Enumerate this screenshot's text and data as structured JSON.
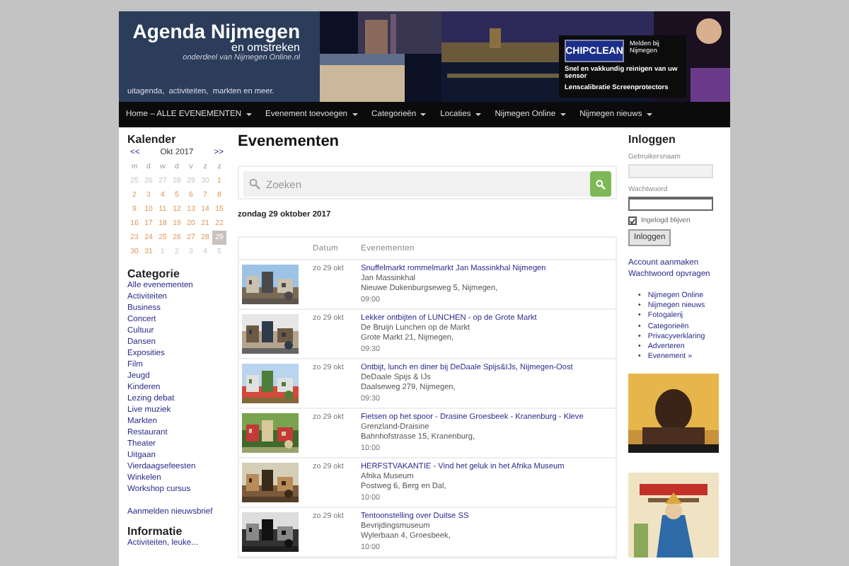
{
  "header": {
    "title": "Agenda Nijmegen",
    "subtitle": "en omstreken",
    "tagline": "onderdeel van Nijmegen Online.nl",
    "slogan": "uitagenda,  activiteiten,  markten en meer.",
    "ad": {
      "logo": "CHIPCLEAN",
      "side": "Melden bij Nijmegen",
      "lines": [
        "Snel en vakkundig reinigen van uw sensor",
        "Lenscalibratie  Screenprotectors"
      ]
    }
  },
  "nav": [
    {
      "label": "Home – ALLE EVENEMENTEN",
      "dropdown": true
    },
    {
      "label": "Evenement toevoegen",
      "dropdown": true
    },
    {
      "label": "Categorieën",
      "dropdown": true
    },
    {
      "label": "Locaties",
      "dropdown": true
    },
    {
      "label": "Nijmegen Online",
      "dropdown": true
    },
    {
      "label": "Nijmegen nieuws",
      "dropdown": true
    }
  ],
  "calendar": {
    "title": "Kalender",
    "prev": "<<",
    "month": "Okt 2017",
    "next": ">>",
    "weekdays": [
      "m",
      "d",
      "w",
      "d",
      "v",
      "z",
      "z"
    ],
    "days": [
      {
        "day": "25",
        "in_month": false,
        "selected": false
      },
      {
        "day": "26",
        "in_month": false,
        "selected": false
      },
      {
        "day": "27",
        "in_month": false,
        "selected": false
      },
      {
        "day": "28",
        "in_month": false,
        "selected": false
      },
      {
        "day": "29",
        "in_month": false,
        "selected": false
      },
      {
        "day": "30",
        "in_month": false,
        "selected": false
      },
      {
        "day": "1",
        "in_month": true,
        "selected": false
      },
      {
        "day": "2",
        "in_month": true,
        "selected": false
      },
      {
        "day": "3",
        "in_month": true,
        "selected": false
      },
      {
        "day": "4",
        "in_month": true,
        "selected": false
      },
      {
        "day": "5",
        "in_month": true,
        "selected": false
      },
      {
        "day": "6",
        "in_month": true,
        "selected": false
      },
      {
        "day": "7",
        "in_month": true,
        "selected": false
      },
      {
        "day": "8",
        "in_month": true,
        "selected": false
      },
      {
        "day": "9",
        "in_month": true,
        "selected": false
      },
      {
        "day": "10",
        "in_month": true,
        "selected": false
      },
      {
        "day": "11",
        "in_month": true,
        "selected": false
      },
      {
        "day": "12",
        "in_month": true,
        "selected": false
      },
      {
        "day": "13",
        "in_month": true,
        "selected": false
      },
      {
        "day": "14",
        "in_month": true,
        "selected": false
      },
      {
        "day": "15",
        "in_month": true,
        "selected": false
      },
      {
        "day": "16",
        "in_month": true,
        "selected": false
      },
      {
        "day": "17",
        "in_month": true,
        "selected": false
      },
      {
        "day": "18",
        "in_month": true,
        "selected": false
      },
      {
        "day": "19",
        "in_month": true,
        "selected": false
      },
      {
        "day": "20",
        "in_month": true,
        "selected": false
      },
      {
        "day": "21",
        "in_month": true,
        "selected": false
      },
      {
        "day": "22",
        "in_month": true,
        "selected": false
      },
      {
        "day": "23",
        "in_month": true,
        "selected": false
      },
      {
        "day": "24",
        "in_month": true,
        "selected": false
      },
      {
        "day": "25",
        "in_month": true,
        "selected": false
      },
      {
        "day": "26",
        "in_month": true,
        "selected": false
      },
      {
        "day": "27",
        "in_month": true,
        "selected": false
      },
      {
        "day": "28",
        "in_month": true,
        "selected": false
      },
      {
        "day": "29",
        "in_month": true,
        "selected": true
      },
      {
        "day": "30",
        "in_month": true,
        "selected": false
      },
      {
        "day": "31",
        "in_month": true,
        "selected": false
      },
      {
        "day": "1",
        "in_month": false,
        "selected": false
      },
      {
        "day": "2",
        "in_month": false,
        "selected": false
      },
      {
        "day": "3",
        "in_month": false,
        "selected": false
      },
      {
        "day": "4",
        "in_month": false,
        "selected": false
      },
      {
        "day": "5",
        "in_month": false,
        "selected": false
      }
    ]
  },
  "categories": {
    "title": "Categorie",
    "items": [
      "Alle evenementen",
      "Activiteiten",
      "Business",
      "Concert",
      "Cultuur",
      "Dansen",
      "Exposities",
      "Film",
      "Jeugd",
      "Kinderen",
      "Lezing debat",
      "Live muziek",
      "Markten",
      "Restaurant",
      "Theater",
      "Uitgaan",
      "Vierdaagsefeesten",
      "Winkelen",
      "Workshop cursus"
    ]
  },
  "newsletter_link": "Aanmelden nieuwsbrief",
  "info": {
    "title": "Informatie",
    "items": [
      "Activiteiten, leuke..."
    ]
  },
  "main": {
    "title": "Evenementen",
    "search": {
      "placeholder": "Zoeken"
    },
    "date_heading": "zondag 29 oktober 2017",
    "columns": [
      "Datum",
      "Evenementen"
    ],
    "rows": [
      {
        "date": "zo 29 okt",
        "title": "Snuffelmarkt rommelmarkt Jan Massinkhal Nijmegen",
        "venue": "Jan Massinkhal",
        "address": "Nieuwe Dukenburgseweg 5, Nijmegen,",
        "time": "09:00"
      },
      {
        "date": "zo 29 okt",
        "title": "Lekker ontbijten of LUNCHEN - op de Grote Markt",
        "venue": "De Bruijn Lunchen op de Markt",
        "address": "Grote Markt 21, Nijmegen,",
        "time": "09:30"
      },
      {
        "date": "zo 29 okt",
        "title": "Ontbijt, lunch en diner bij DeDaale Spijs&IJs, Nijmegen-Oost",
        "venue": "DeDaale Spijs & IJs",
        "address": "Daalseweg 279, Nijmegen,",
        "time": "09:30"
      },
      {
        "date": "zo 29 okt",
        "title": "Fietsen op het spoor - Drasine Groesbeek - Kranenburg - Kleve",
        "venue": "Grenzland-Draisine",
        "address": "Bahnhofstrasse 15, Kranenburg,",
        "time": "10:00"
      },
      {
        "date": "zo 29 okt",
        "title": "HERFSTVAKANTIE - Vind het geluk in het Afrika Museum",
        "venue": "Afrika Museum",
        "address": "Postweg 6, Berg en Dal,",
        "time": "10:00"
      },
      {
        "date": "zo 29 okt",
        "title": "Tentoonstelling over Duitse SS",
        "venue": "Bevrijdingsmuseum",
        "address": "Wylerbaan 4, Groesbeek,",
        "time": "10:00"
      }
    ]
  },
  "login": {
    "title": "Inloggen",
    "username_label": "Gebruikersnaam",
    "password_label": "Wachtwoord",
    "remember": {
      "label": "Ingelogd blijven",
      "checked": true
    },
    "button": "Inloggen",
    "links": [
      "Account aanmaken",
      "Wachtwoord opvragen"
    ],
    "menu": [
      {
        "marker": "•",
        "label": "Nijmegen Online"
      },
      {
        "marker": "•",
        "label": "Nijmegen nieuws"
      },
      {
        "marker": "•",
        "label": "Fotogalerij"
      },
      {
        "marker": "•",
        "label": "Categorieën"
      },
      {
        "marker": "•",
        "label": "Privacyverklaring"
      },
      {
        "marker": "•",
        "label": "Adverteren"
      },
      {
        "marker": "•",
        "label": "Evenement »"
      }
    ]
  }
}
